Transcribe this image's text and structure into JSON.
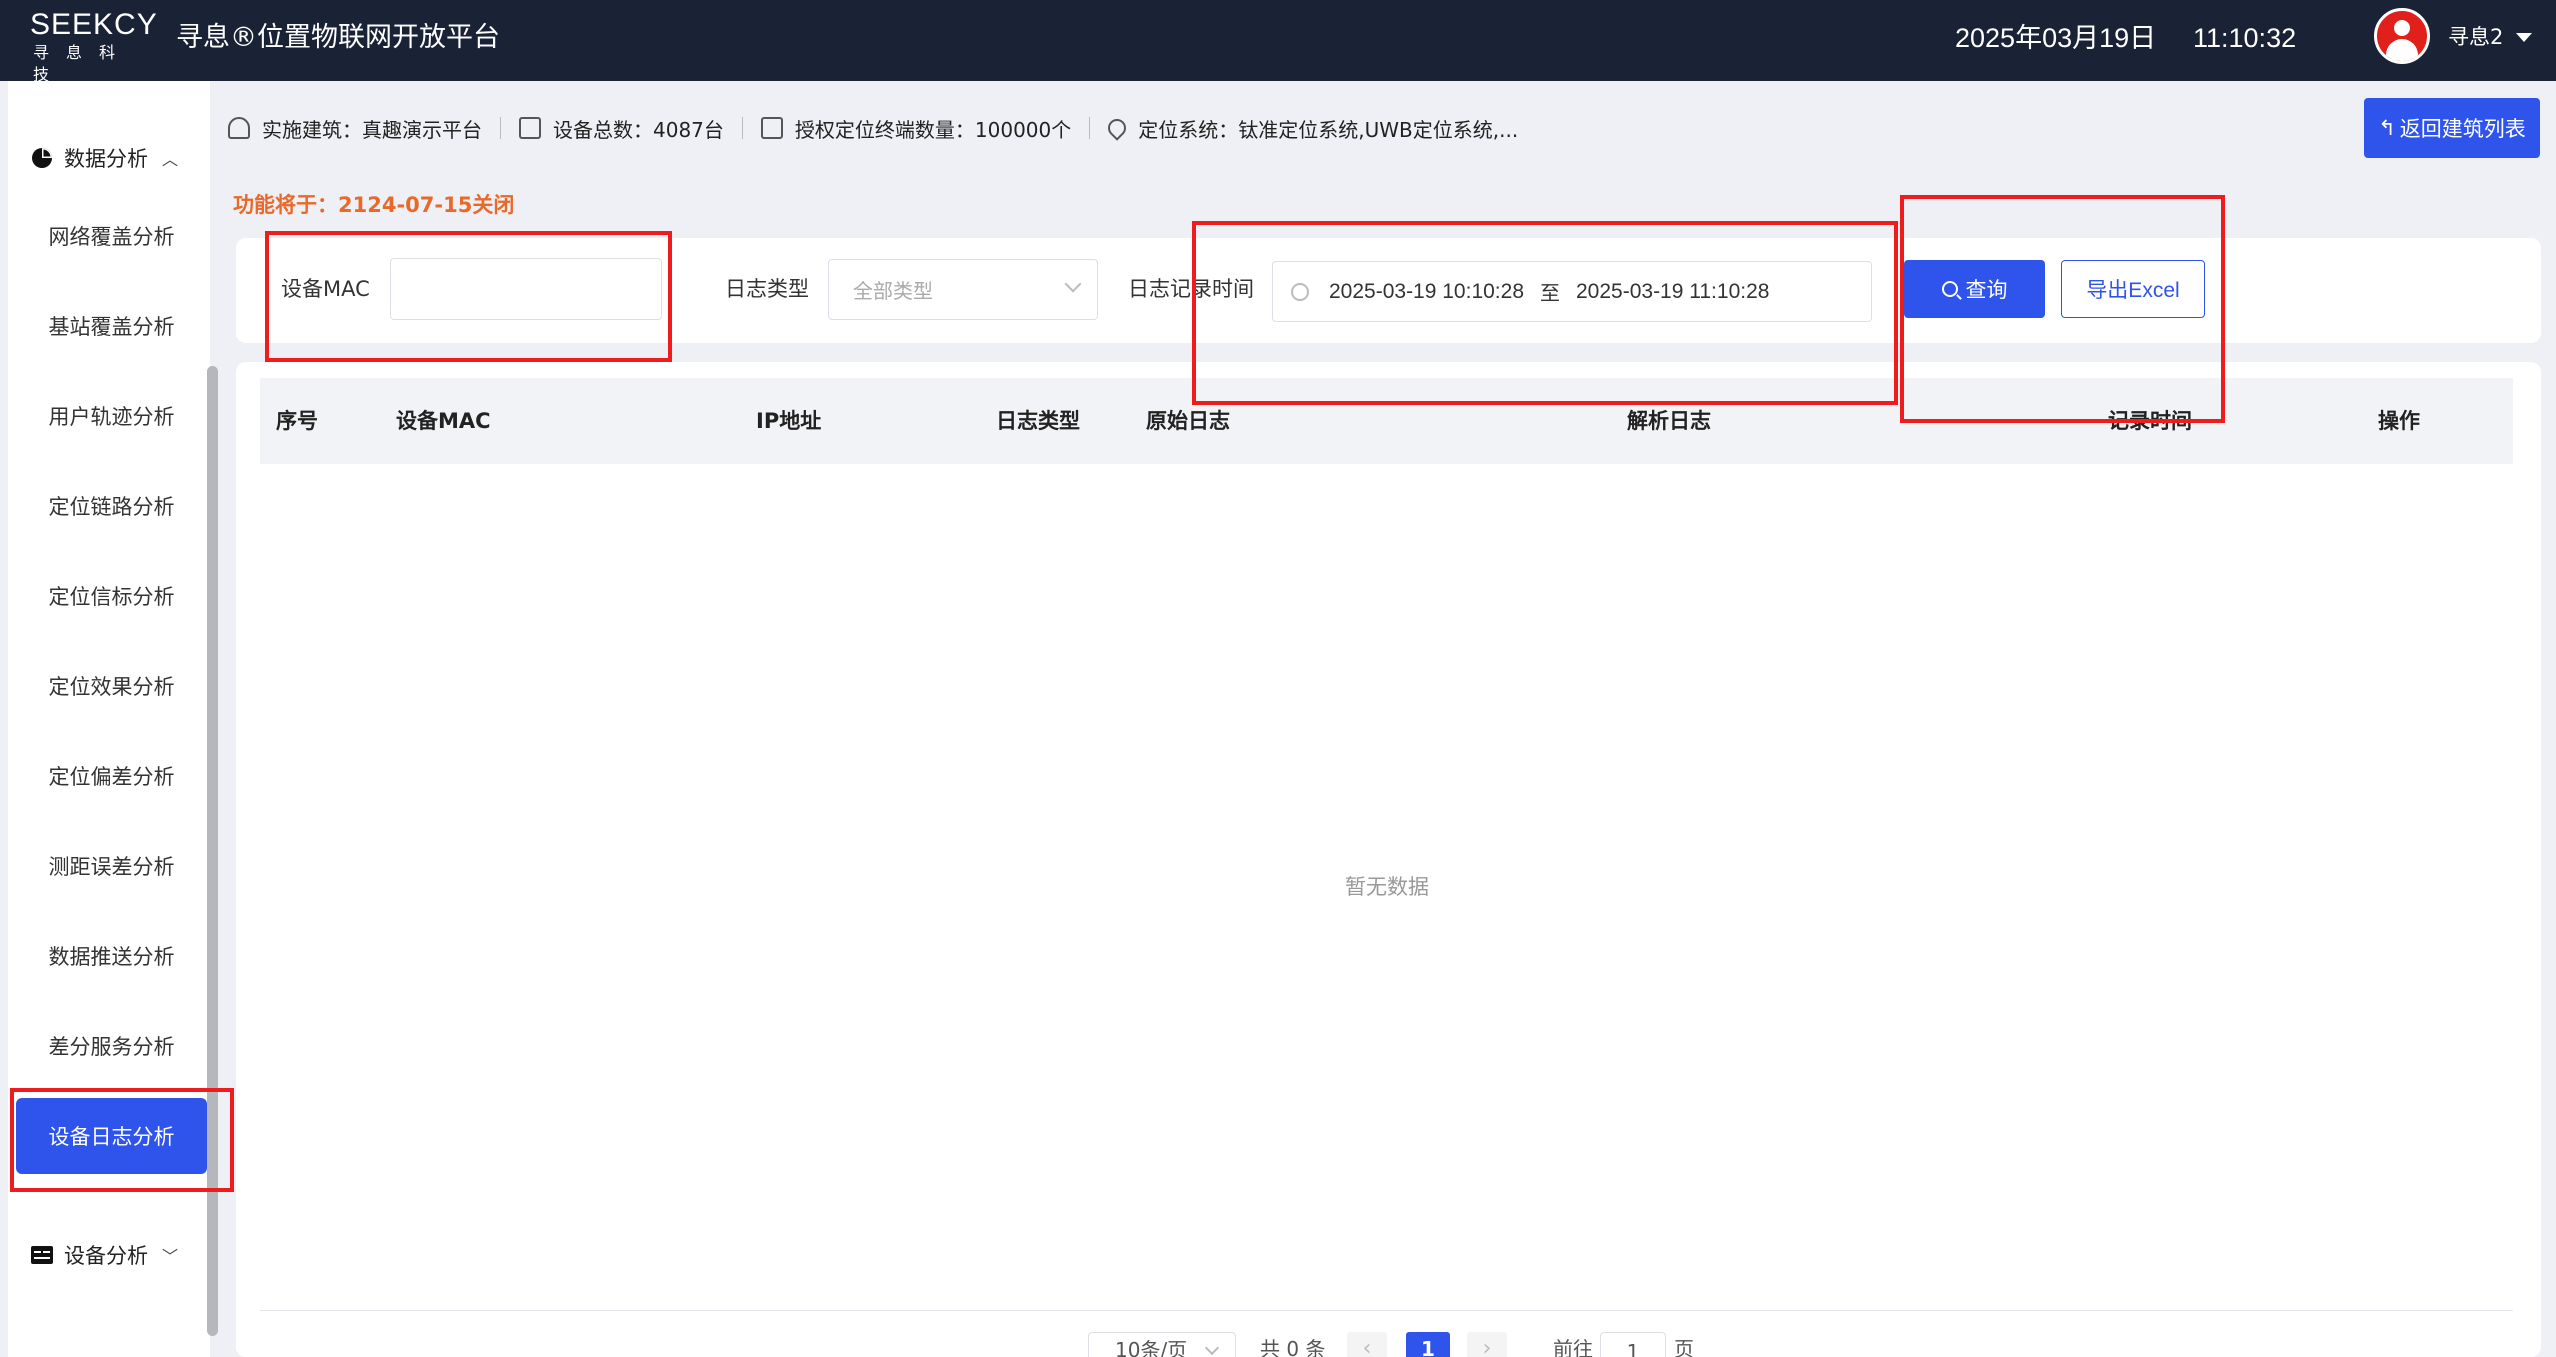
{
  "header": {
    "logo_main": "SEEKCY",
    "logo_sub": "寻息科技",
    "app_title": "寻息®位置物联网开放平台",
    "date": "2025年03月19日",
    "time": "11:10:32",
    "user_name": "寻息2"
  },
  "sidebar": {
    "group_data_analysis": "数据分析",
    "items": [
      {
        "label": "网络覆盖分析"
      },
      {
        "label": "基站覆盖分析"
      },
      {
        "label": "用户轨迹分析"
      },
      {
        "label": "定位链路分析"
      },
      {
        "label": "定位信标分析"
      },
      {
        "label": "定位效果分析"
      },
      {
        "label": "定位偏差分析"
      },
      {
        "label": "测距误差分析"
      },
      {
        "label": "数据推送分析"
      },
      {
        "label": "差分服务分析"
      },
      {
        "label": "设备日志分析"
      }
    ],
    "active_item": "设备日志分析",
    "group_device_analysis": "设备分析"
  },
  "info_bar": {
    "building": "实施建筑：真趣演示平台",
    "device_total": "设备总数：4087台",
    "licensed_terminals": "授权定位终端数量：100000个",
    "positioning_system": "定位系统：钛准定位系统,UWB定位系统,..."
  },
  "back_button": "返回建筑列表",
  "notice": "功能将于：2124-07-15关闭",
  "search": {
    "mac_label": "设备MAC",
    "mac_value": "",
    "type_label": "日志类型",
    "type_value": "全部类型",
    "time_label": "日志记录时间",
    "start_time": "2025-03-19 10:10:28",
    "range_sep": "至",
    "end_time": "2025-03-19 11:10:28",
    "query_button": "查询",
    "export_button": "导出Excel"
  },
  "table": {
    "columns": [
      "序号",
      "设备MAC",
      "IP地址",
      "日志类型",
      "原始日志",
      "解析日志",
      "记录时间",
      "操作"
    ],
    "rows": [],
    "empty_text": "暂无数据"
  },
  "pagination": {
    "page_size": "10条/页",
    "total": "共 0 条",
    "current_page": "1",
    "goto_label": "前往",
    "goto_value": "1",
    "goto_suffix": "页"
  },
  "colors": {
    "header_bg": "#1a2236",
    "primary": "#2f54eb",
    "notice": "#e8692a",
    "annotation": "#ee1c1c"
  }
}
